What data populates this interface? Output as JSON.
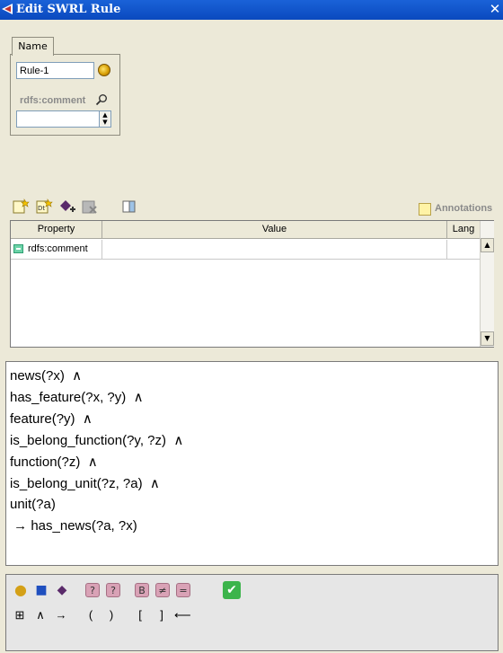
{
  "window": {
    "title": "Edit SWRL Rule",
    "close_glyph": "✕"
  },
  "name_tab": {
    "label": "Name"
  },
  "name_field": {
    "value": "Rule-1"
  },
  "comment": {
    "label": "rdfs:comment",
    "value": ""
  },
  "toolbar": {
    "icons": [
      "create-annotation-icon",
      "create-datatype-annotation-icon",
      "add-property-icon",
      "delete-annotation-icon",
      "view-icon"
    ],
    "annotations_label": "Annotations"
  },
  "table": {
    "columns": [
      "Property",
      "Value",
      "Lang"
    ],
    "rows": [
      {
        "property": "rdfs:comment",
        "value": "",
        "lang": ""
      }
    ]
  },
  "rule": {
    "lines": [
      "news(?x)  ∧",
      "has_feature(?x, ?y)  ∧",
      "feature(?y)  ∧",
      "is_belong_function(?y, ?z)  ∧",
      "function(?z)  ∧",
      "is_belong_unit(?z, ?a)  ∧",
      "unit(?a)",
      " → has_news(?a, ?x)"
    ]
  },
  "palette": {
    "row1": [
      "●",
      "■",
      "◆",
      "?",
      "?",
      "B",
      "≠",
      "=",
      "✔"
    ],
    "row2": [
      "⊞",
      "∧",
      "→",
      "(",
      ")",
      "[",
      "]",
      "⟵"
    ],
    "colors": {
      "class": "#d4a017",
      "property": "#1f4fbf",
      "individual": "#5a2a6a",
      "builtin": "#d9a2b6",
      "ok": "#3cb44b"
    }
  }
}
